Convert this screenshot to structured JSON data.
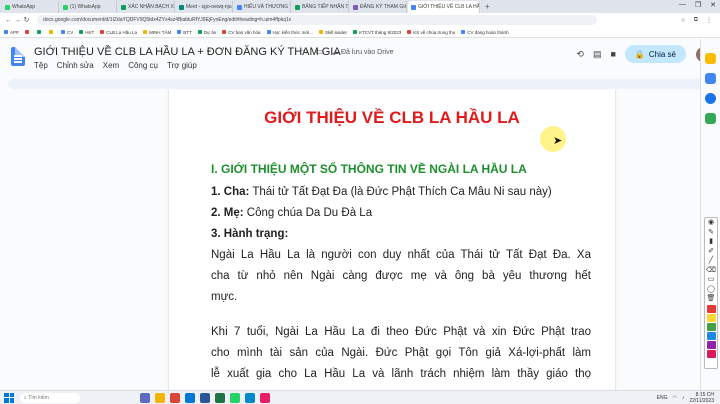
{
  "browser": {
    "tabs": [
      {
        "label": "WhatsApp",
        "color": "#25d366"
      },
      {
        "label": "(1) WhatsApp",
        "color": "#25d366"
      },
      {
        "label": "XÁC NHẬN BẠCH XNTT DAO",
        "color": "#0f9d58"
      },
      {
        "label": "Meet - sgo-oewq-nju",
        "color": "#00897b"
      },
      {
        "label": "HIẾU VÀ THƯƠNG TỔNG HỢ",
        "color": "#4285f4"
      },
      {
        "label": "BẢNG TIẾP NHẬN THÔNG TIN",
        "color": "#0f9d58"
      },
      {
        "label": "ĐĂNG KÝ THAM GIA CÂU LẠ",
        "color": "#7e57c2"
      },
      {
        "label": "GIỚI THIỆU VỀ CLB LA HẦU LA",
        "color": "#4285f4"
      }
    ],
    "new_tab": "+",
    "window_controls": [
      "—",
      "❐",
      "✕"
    ],
    "url": "docs.google.com/document/d/1IZdaYQDFV9Q5tdx4ZYx4sz4BiabluRfYJ9EjFyoEng/edit#heading=h.uim4ffpkq1v",
    "bookmarks": [
      {
        "label": "APP",
        "color": "#4285f4"
      },
      {
        "label": "",
        "color": "#db4437"
      },
      {
        "label": "",
        "color": "#0f9d58"
      },
      {
        "label": "",
        "color": "#f4b400"
      },
      {
        "label": "CV",
        "color": "#4285f4"
      },
      {
        "label": "HKT",
        "color": "#0f9d58"
      },
      {
        "label": "CLB La Hầu La",
        "color": "#db4437"
      },
      {
        "label": "MINH TÂM",
        "color": "#f4b400"
      },
      {
        "label": "BTT",
        "color": "#4285f4"
      },
      {
        "label": "Dự án",
        "color": "#0f9d58"
      },
      {
        "label": "CV ban văn hóa",
        "color": "#db4437"
      },
      {
        "label": "Học kiến thức mới...",
        "color": "#4285f4"
      },
      {
        "label": "Skill leader",
        "color": "#f4b400"
      },
      {
        "label": "KTCVT tháng 9/2023",
        "color": "#0f9d58"
      },
      {
        "label": "KS về chùa trung thu",
        "color": "#db4437"
      },
      {
        "label": "CV đang hoàn thành",
        "color": "#4285f4"
      }
    ]
  },
  "docs": {
    "title": "GIỚI THIỆU VỀ CLB LA HẦU LA + ĐƠN ĐĂNG KÝ THAM GIA",
    "saved_status": "Đã lưu vào Drive",
    "menu": [
      "Tệp",
      "Chỉnh sửa",
      "Xem",
      "Công cụ",
      "Trợ giúp"
    ],
    "share_label": "Chia sẻ"
  },
  "document": {
    "heading": "GIỚI THIỆU VỀ CLB LA HẦU LA",
    "section_title": "I. GIỚI THIỆU MỘT SỐ THÔNG TIN VỀ NGÀI LA HẦU LA",
    "fields": [
      {
        "label": "1. Cha:",
        "value": " Thái tử Tất Đạt Đa (là Đức Phật Thích Ca Mâu Ni sau này)"
      },
      {
        "label": "2. Mẹ:",
        "value": " Công chúa Da Du Đà La"
      },
      {
        "label": "3. Hành trạng:",
        "value": ""
      }
    ],
    "paragraph1": [
      "Ngài La Hầu La là người con duy nhất của Thái tử Tất Đạt Đa. Xa",
      "cha từ nhỏ nên Ngài càng được mẹ và ông bà yêu thương hết",
      "mực."
    ],
    "paragraph2": [
      "Khi 7 tuổi, Ngài La Hầu La đi theo Đức Phật và xin Đức Phật trao",
      "cho mình tài sản của Ngài. Đức Phật gọi Tôn giả Xá-lợi-phất làm",
      "lễ xuất gia cho La Hầu La và lãnh trách nhiệm làm thầy giáo thọ"
    ]
  },
  "taskbar": {
    "search_placeholder": "Tìm kiếm",
    "language": "ENG",
    "time": "8:15 CH",
    "date": "22/11/2023"
  }
}
